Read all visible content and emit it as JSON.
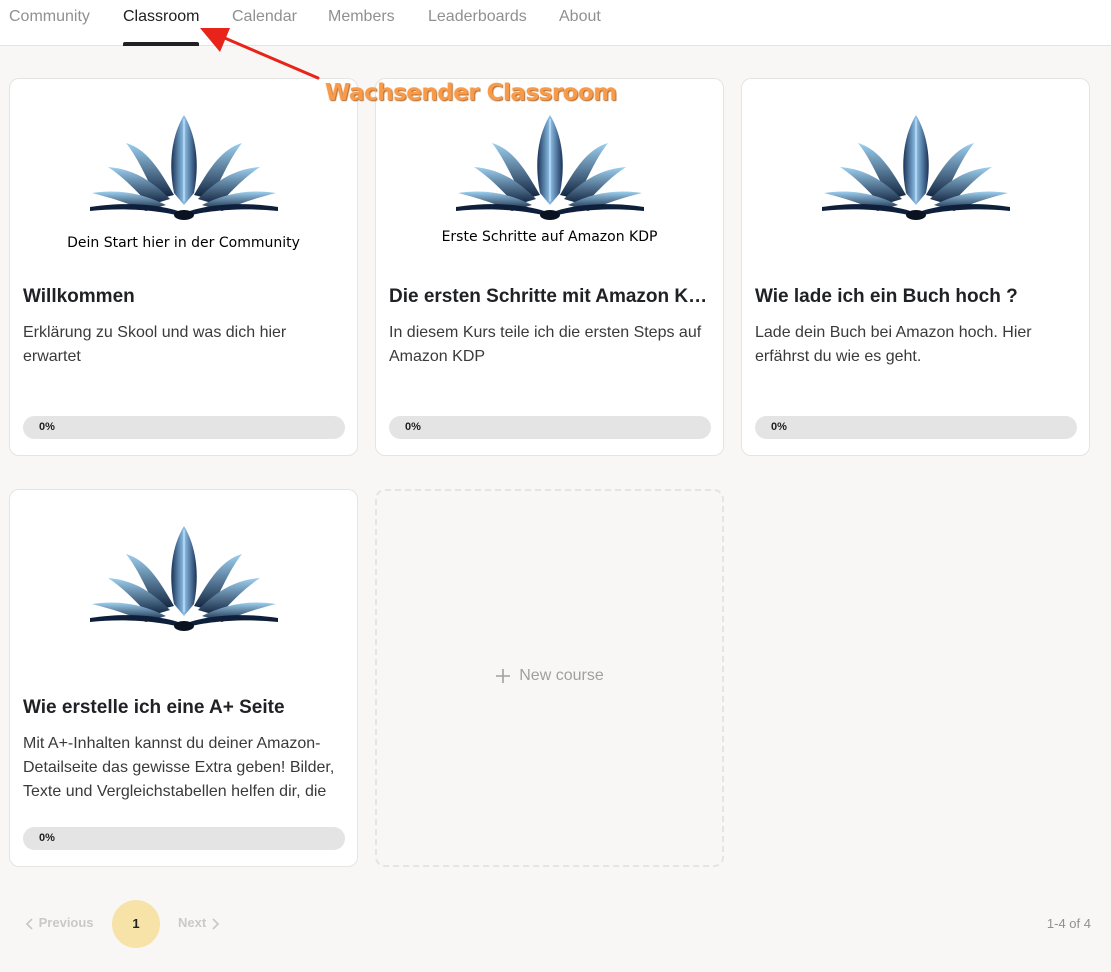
{
  "nav": {
    "tabs": [
      {
        "label": "Community"
      },
      {
        "label": "Classroom",
        "active": true
      },
      {
        "label": "Calendar"
      },
      {
        "label": "Members"
      },
      {
        "label": "Leaderboards"
      },
      {
        "label": "About"
      }
    ]
  },
  "annotation": {
    "text": "Wachsender Classroom",
    "color": "#f79b4a",
    "arrow_color": "#e8231a"
  },
  "courses": [
    {
      "image_caption": "Dein Start hier in der Community",
      "title": "Willkommen",
      "description": "Erklärung zu Skool und was dich hier erwartet",
      "progress_label": "0%",
      "progress": 0
    },
    {
      "image_caption": "Erste Schritte auf Amazon KDP",
      "title": "Die ersten Schritte mit Amazon KDP",
      "description": "In diesem Kurs teile ich die ersten Steps auf Amazon KDP",
      "progress_label": "0%",
      "progress": 0
    },
    {
      "image_caption": "",
      "title": "Wie lade ich ein Buch hoch ?",
      "description": "Lade dein Buch bei Amazon hoch. Hier erfährst du wie es geht.",
      "progress_label": "0%",
      "progress": 0
    },
    {
      "image_caption": "",
      "title": "Wie erstelle ich eine A+ Seite",
      "description": "Mit A+-Inhalten kannst du deiner Amazon-Detailseite das gewisse Extra geben! Bilder, Texte und Vergleichstabellen helfen dir, die",
      "progress_label": "0%",
      "progress": 0
    }
  ],
  "new_course": {
    "label": "New course",
    "icon": "plus-icon"
  },
  "pagination": {
    "previous": "Previous",
    "next": "Next",
    "current_page": "1",
    "range": "1-4 of 4"
  },
  "colors": {
    "page_bg": "#f8f7f5",
    "card_bg": "#ffffff",
    "active_tab": "#202124",
    "inactive_tab": "#909090",
    "progress_track": "#e4e4e4",
    "page_pill": "#f7e3a8",
    "book_dark": "#0d1f3a",
    "book_light": "#8fc3ea"
  }
}
